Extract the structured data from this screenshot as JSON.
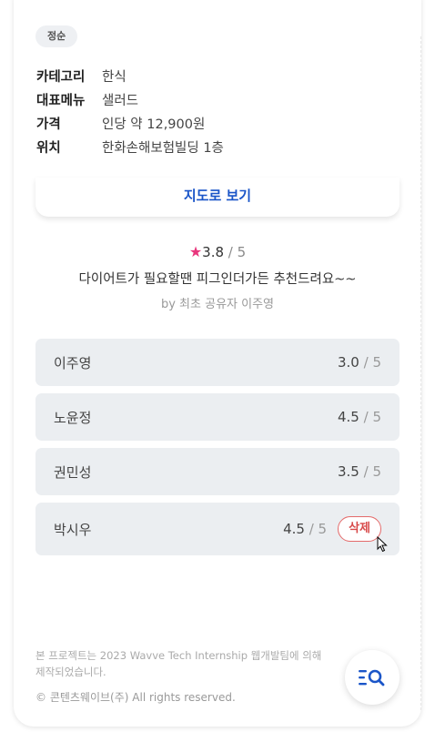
{
  "tag": "정순",
  "info": [
    {
      "key": "카테고리",
      "value": "한식"
    },
    {
      "key": "대표메뉴",
      "value": "샐러드"
    },
    {
      "key": "가격",
      "value": "인당 약 12,900원"
    },
    {
      "key": "위치",
      "value": "한화손해보험빌딩 1층"
    }
  ],
  "map_button": "지도로 보기",
  "summary": {
    "star": "★",
    "score": "3.8",
    "max": "/ 5",
    "review": "다이어트가 필요할땐 피그인더가든 추천드려요~~",
    "byline": "by 최초 공유자 이주영"
  },
  "scores": [
    {
      "name": "이주영",
      "score": "3.0",
      "max": "/ 5"
    },
    {
      "name": "노윤정",
      "score": "4.5",
      "max": "/ 5"
    },
    {
      "name": "권민성",
      "score": "3.5",
      "max": "/ 5"
    },
    {
      "name": "박시우",
      "score": "4.5",
      "max": "/ 5",
      "delete_label": "삭제"
    }
  ],
  "footer": {
    "line1": "본 프로젝트는 2023 Wavve Tech Internship 웹개발팀에 의해",
    "line2": "제작되었습니다.",
    "copyright": "© 콘텐츠웨이브(주) All rights reserved."
  },
  "colors": {
    "accent": "#1a55c8",
    "star": "#e8357c",
    "delete": "#d84a4a"
  },
  "icons": {
    "fab": "search-list-icon"
  }
}
